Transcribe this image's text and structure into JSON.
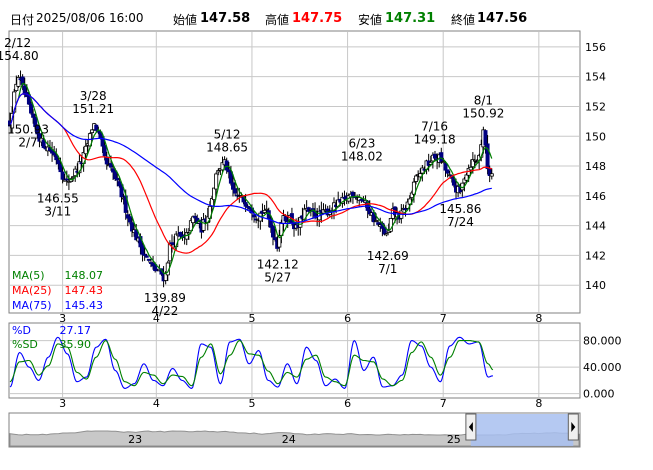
{
  "header": {
    "date_label": "日付",
    "datetime": "2025/08/06 16:00",
    "open_label": "始値",
    "open": "147.58",
    "high_label": "高値",
    "high": "147.75",
    "low_label": "安値",
    "low": "147.31",
    "close_label": "終値",
    "close": "147.56"
  },
  "colors": {
    "up_candle": "#ffffff",
    "down_candle": "#000080",
    "ma5": "#008000",
    "ma25": "#ff0000",
    "ma75": "#0000ff",
    "pctd": "#0000ff",
    "pctsd": "#008000",
    "grid": "#c8c8c8",
    "slider_fill": "#a8c0f0"
  },
  "ma_legend": [
    {
      "label": "MA(5)",
      "value": "148.07",
      "color": "#008000"
    },
    {
      "label": "MA(25)",
      "value": "147.43",
      "color": "#ff0000"
    },
    {
      "label": "MA(75)",
      "value": "145.43",
      "color": "#0000ff"
    }
  ],
  "osc_legend": [
    {
      "label": "%D",
      "value": "27.17",
      "color": "#0000ff"
    },
    {
      "label": "%SD",
      "value": "35.90",
      "color": "#008000"
    }
  ],
  "annotations": [
    {
      "text": "2/12",
      "x": 0.08,
      "y": 154.8,
      "anchor": "top"
    },
    {
      "text": "154.80",
      "x": 0.08,
      "y": 154.8,
      "anchor": "top2"
    },
    {
      "text": "150.93",
      "x": 0.0,
      "y": 150.93,
      "anchor": "left1"
    },
    {
      "text": "2/7",
      "x": 0.0,
      "y": 150.93,
      "anchor": "left2"
    },
    {
      "text": "146.55",
      "x": 0.5,
      "y": 146.55,
      "anchor": "bottom1"
    },
    {
      "text": "3/11",
      "x": 0.5,
      "y": 146.55,
      "anchor": "bottom2"
    },
    {
      "text": "3/28",
      "x": 0.87,
      "y": 151.21,
      "anchor": "top"
    },
    {
      "text": "151.21",
      "x": 0.87,
      "y": 151.21,
      "anchor": "top2"
    },
    {
      "text": "139.89",
      "x": 1.62,
      "y": 139.89,
      "anchor": "bottom1"
    },
    {
      "text": "4/22",
      "x": 1.62,
      "y": 139.89,
      "anchor": "bottom2"
    },
    {
      "text": "5/12",
      "x": 2.27,
      "y": 148.65,
      "anchor": "top"
    },
    {
      "text": "148.65",
      "x": 2.27,
      "y": 148.65,
      "anchor": "top2"
    },
    {
      "text": "142.12",
      "x": 2.8,
      "y": 142.12,
      "anchor": "bottom1"
    },
    {
      "text": "5/27",
      "x": 2.8,
      "y": 142.12,
      "anchor": "bottom2"
    },
    {
      "text": "6/23",
      "x": 3.68,
      "y": 148.02,
      "anchor": "top"
    },
    {
      "text": "148.02",
      "x": 3.68,
      "y": 148.02,
      "anchor": "top2"
    },
    {
      "text": "142.69",
      "x": 3.95,
      "y": 142.69,
      "anchor": "bottom1"
    },
    {
      "text": "7/1",
      "x": 3.95,
      "y": 142.69,
      "anchor": "bottom2"
    },
    {
      "text": "7/16",
      "x": 4.44,
      "y": 149.18,
      "anchor": "top"
    },
    {
      "text": "149.18",
      "x": 4.44,
      "y": 149.18,
      "anchor": "top2"
    },
    {
      "text": "145.86",
      "x": 4.71,
      "y": 145.86,
      "anchor": "bottom1"
    },
    {
      "text": "7/24",
      "x": 4.71,
      "y": 145.86,
      "anchor": "bottom2"
    },
    {
      "text": "8/1",
      "x": 4.95,
      "y": 150.92,
      "anchor": "top"
    },
    {
      "text": "150.92",
      "x": 4.95,
      "y": 150.92,
      "anchor": "top2"
    }
  ],
  "chart_data": [
    {
      "type": "candlestick",
      "title": "",
      "y_ticks": [
        140,
        142,
        144,
        146,
        148,
        150,
        152,
        154,
        156
      ],
      "ylim": [
        138.2,
        157.0
      ],
      "x_ticks": [
        {
          "label": "3",
          "x": 0.55
        },
        {
          "label": "4",
          "x": 1.53
        },
        {
          "label": "5",
          "x": 2.53
        },
        {
          "label": "6",
          "x": 3.53
        },
        {
          "label": "7",
          "x": 4.53
        },
        {
          "label": "8",
          "x": 5.53
        }
      ],
      "xlim": [
        0.0,
        5.95
      ],
      "close_series": {
        "x": [
          0.0,
          0.08,
          0.17,
          0.25,
          0.33,
          0.42,
          0.5,
          0.58,
          0.67,
          0.75,
          0.83,
          0.87,
          0.92,
          1.0,
          1.08,
          1.17,
          1.25,
          1.33,
          1.42,
          1.5,
          1.58,
          1.62,
          1.67,
          1.75,
          1.83,
          1.92,
          2.0,
          2.08,
          2.17,
          2.25,
          2.27,
          2.33,
          2.42,
          2.5,
          2.58,
          2.67,
          2.75,
          2.8,
          2.83,
          2.92,
          3.0,
          3.08,
          3.17,
          3.25,
          3.33,
          3.42,
          3.5,
          3.58,
          3.68,
          3.75,
          3.83,
          3.92,
          3.95,
          4.0,
          4.08,
          4.17,
          4.25,
          4.33,
          4.44,
          4.5,
          4.58,
          4.66,
          4.71,
          4.75,
          4.83,
          4.9,
          4.95,
          5.0,
          5.05
        ],
        "y": [
          150.93,
          154.2,
          152.5,
          150.8,
          149.6,
          149.1,
          148.4,
          146.8,
          147.5,
          148.3,
          149.8,
          150.9,
          150.3,
          148.2,
          147.5,
          146.0,
          144.3,
          143.1,
          141.9,
          141.1,
          140.8,
          140.4,
          142.6,
          143.3,
          143.0,
          144.6,
          143.8,
          145.0,
          147.8,
          148.2,
          147.8,
          146.2,
          145.8,
          145.4,
          144.6,
          145.1,
          143.5,
          142.6,
          144.3,
          144.6,
          143.7,
          145.0,
          144.8,
          144.7,
          145.0,
          145.4,
          145.7,
          146.2,
          145.8,
          145.1,
          144.2,
          143.5,
          143.2,
          144.9,
          144.6,
          145.6,
          147.2,
          147.9,
          148.6,
          148.5,
          147.4,
          146.5,
          146.2,
          147.3,
          148.3,
          148.4,
          150.5,
          147.5,
          147.56
        ]
      },
      "series": [
        {
          "name": "MA(5)",
          "last": 148.07
        },
        {
          "name": "MA(25)",
          "last": 147.43
        },
        {
          "name": "MA(75)",
          "last": 145.43
        }
      ]
    },
    {
      "type": "line",
      "title": "",
      "y_ticks": [
        0,
        40,
        80
      ],
      "y_tick_labels": [
        "0.000",
        "40.000",
        "80.000"
      ],
      "ylim": [
        -5,
        105
      ],
      "series": [
        {
          "name": "%D",
          "last": 27.17,
          "x": [
            0.0,
            0.1,
            0.2,
            0.3,
            0.4,
            0.5,
            0.6,
            0.7,
            0.8,
            0.9,
            1.0,
            1.1,
            1.2,
            1.3,
            1.4,
            1.5,
            1.6,
            1.7,
            1.8,
            1.9,
            2.0,
            2.1,
            2.2,
            2.3,
            2.4,
            2.5,
            2.6,
            2.7,
            2.8,
            2.9,
            3.0,
            3.1,
            3.2,
            3.3,
            3.4,
            3.5,
            3.6,
            3.7,
            3.8,
            3.9,
            4.0,
            4.1,
            4.2,
            4.3,
            4.4,
            4.5,
            4.6,
            4.7,
            4.8,
            4.9,
            5.0,
            5.05
          ],
          "y": [
            10,
            62,
            40,
            20,
            55,
            85,
            60,
            18,
            25,
            70,
            82,
            35,
            8,
            15,
            45,
            20,
            12,
            38,
            20,
            8,
            75,
            70,
            15,
            78,
            82,
            45,
            65,
            20,
            10,
            45,
            15,
            70,
            50,
            12,
            22,
            8,
            80,
            35,
            55,
            10,
            12,
            28,
            80,
            72,
            40,
            18,
            72,
            85,
            75,
            78,
            25,
            27
          ]
        },
        {
          "name": "%SD",
          "last": 35.9,
          "x": [
            0.0,
            0.1,
            0.2,
            0.3,
            0.4,
            0.5,
            0.6,
            0.7,
            0.8,
            0.9,
            1.0,
            1.1,
            1.2,
            1.3,
            1.4,
            1.5,
            1.6,
            1.7,
            1.8,
            1.9,
            2.0,
            2.1,
            2.2,
            2.3,
            2.4,
            2.5,
            2.6,
            2.7,
            2.8,
            2.9,
            3.0,
            3.1,
            3.2,
            3.3,
            3.4,
            3.5,
            3.6,
            3.7,
            3.8,
            3.9,
            4.0,
            4.1,
            4.2,
            4.3,
            4.4,
            4.5,
            4.6,
            4.7,
            4.8,
            4.9,
            5.0,
            5.05
          ],
          "y": [
            18,
            48,
            50,
            28,
            42,
            75,
            70,
            32,
            22,
            55,
            80,
            52,
            18,
            12,
            32,
            28,
            15,
            28,
            26,
            12,
            55,
            75,
            30,
            58,
            80,
            60,
            58,
            34,
            15,
            32,
            25,
            52,
            58,
            25,
            18,
            12,
            58,
            50,
            48,
            22,
            12,
            20,
            62,
            78,
            55,
            28,
            55,
            80,
            80,
            78,
            45,
            36
          ]
        }
      ]
    }
  ],
  "navigator": {
    "x_ticks": [
      {
        "label": "23",
        "x": 0.22
      },
      {
        "label": "24",
        "x": 0.49
      },
      {
        "label": "25",
        "x": 0.78
      }
    ],
    "selection": [
      0.81,
      0.99
    ]
  }
}
